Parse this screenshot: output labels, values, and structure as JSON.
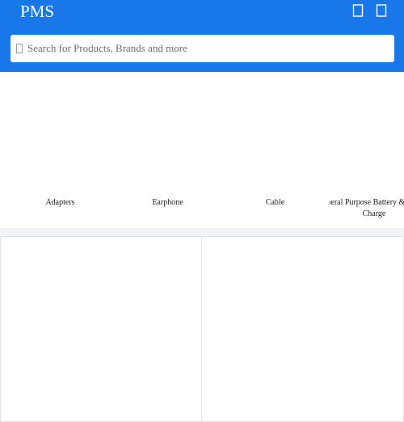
{
  "header": {
    "logo": "PMS",
    "background": "#1877e9",
    "icons": [
      "cart-icon",
      "user-icon"
    ]
  },
  "search": {
    "placeholder": "Search for Products, Brands and more",
    "icon": "search-icon"
  },
  "categories": [
    {
      "label": "Adapters"
    },
    {
      "label": "Earphone"
    },
    {
      "label": "Cable"
    },
    {
      "label": "General Purpose Battery & Battery Charge"
    }
  ]
}
